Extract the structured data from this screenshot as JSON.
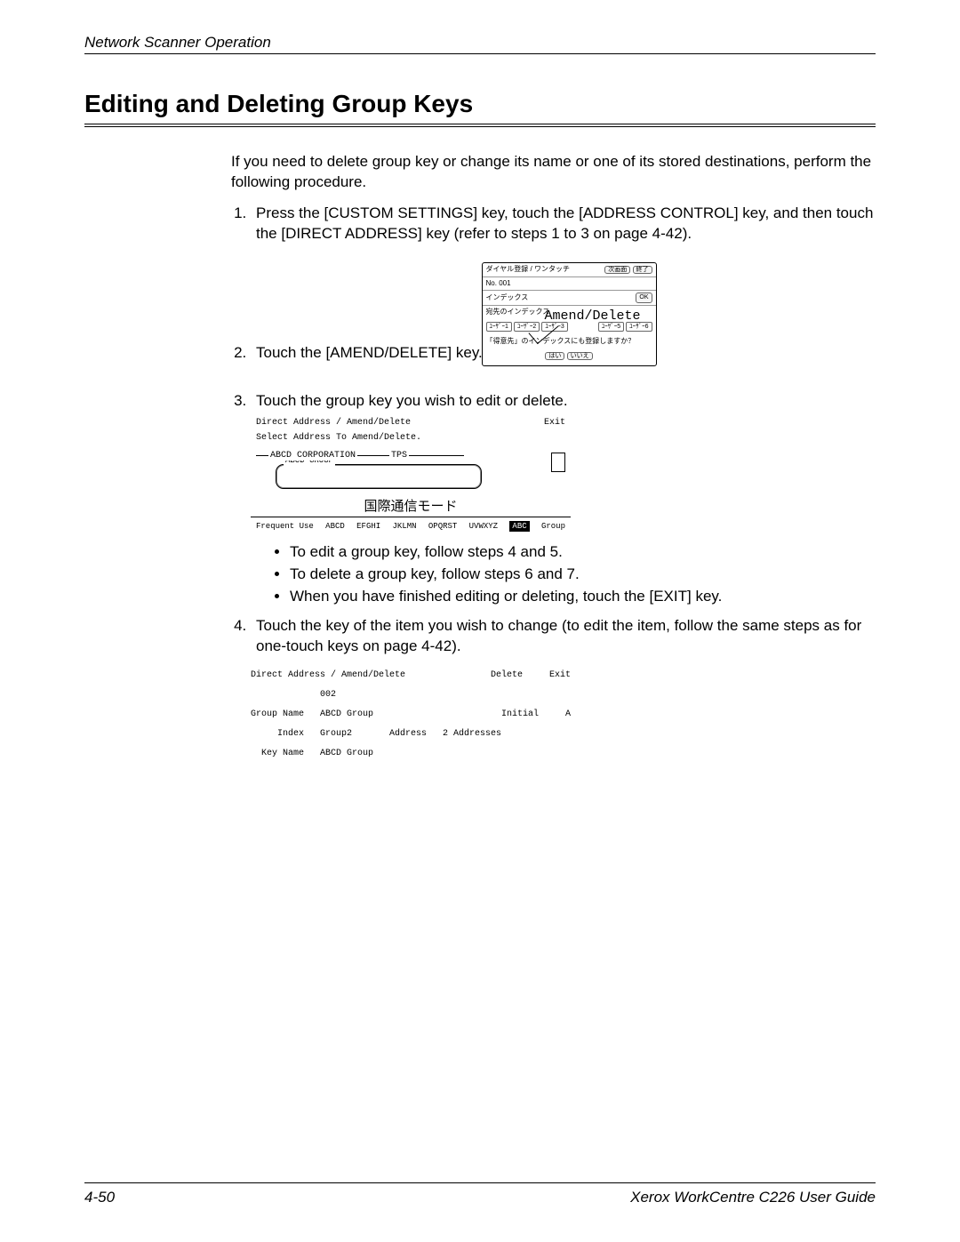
{
  "header": {
    "running": "Network Scanner Operation"
  },
  "title": "Editing and Deleting Group Keys",
  "intro": "If you need to delete group key or change its name or one of its stored destinations, perform the following procedure.",
  "steps": {
    "s1": "Press the [CUSTOM SETTINGS] key, touch the [ADDRESS CONTROL] key, and then touch the [DIRECT ADDRESS] key (refer to steps 1 to 3 on page 4-42).",
    "s2": "Touch the [AMEND/DELETE] key.",
    "s3": "Touch the group key you wish to edit or delete.",
    "s3_bullets": {
      "b1": "To edit a group key, follow steps 4 and 5.",
      "b2": "To delete a group key, follow steps 6 and 7.",
      "b3": "When you have finished editing or deleting, touch the [EXIT] key."
    },
    "s4": "Touch the key of the item you wish to change (to edit the item, follow the same steps as for one-touch keys on page 4-42)."
  },
  "fig1": {
    "title": "ダイヤル登録 / ワンタッチ",
    "next": "次画面",
    "exit": "終了",
    "no": "No. 001",
    "index_label": "インデックス",
    "ok": "OK",
    "dest_index": "宛先のインデックス",
    "callout": "Amend/Delete",
    "tab1": "ﾕｰｻﾞｰ1",
    "tab2": "ﾕｰｻﾞｰ2",
    "tab3": "ﾕｰｻﾞｰ3",
    "tab5": "ﾕｰｻﾞｰ5",
    "tab6": "ﾕｰｻﾞｰ6",
    "confirm": "「得意先」のインデックスにも登録しますか？",
    "yes": "はい",
    "no_btn": "いいえ"
  },
  "fig2": {
    "title_left": "Direct Address / Amend/Delete",
    "exit": "Exit",
    "subtitle": "Select Address To Amend/Delete.",
    "entry1": "ABCD CORPORATION",
    "entry1b": "TPS",
    "box_label": "ABCD GROUP",
    "jp": "国際通信モード",
    "tab_frequent": "Frequent Use",
    "tab_abcd": "ABCD",
    "tab_efghi": "EFGHI",
    "tab_jklmn": "JKLMN",
    "tab_opqrst": "OPQRST",
    "tab_uvwxyz": "UVWXYZ",
    "tab_abc": "ABC",
    "tab_group": "Group"
  },
  "fig3": {
    "title_left": "Direct Address / Amend/Delete",
    "delete": "Delete",
    "exit": "Exit",
    "num": "002",
    "group_name_label": "Group Name",
    "group_name_val": "ABCD Group",
    "initial_label": "Initial",
    "initial_val": "A",
    "index_label": "Index",
    "index_val": "Group2",
    "address_label": "Address",
    "address_val": "2 Addresses",
    "key_name_label": "Key Name",
    "key_name_val": "ABCD Group"
  },
  "footer": {
    "page": "4-50",
    "doc": "Xerox WorkCentre C226 User Guide"
  }
}
